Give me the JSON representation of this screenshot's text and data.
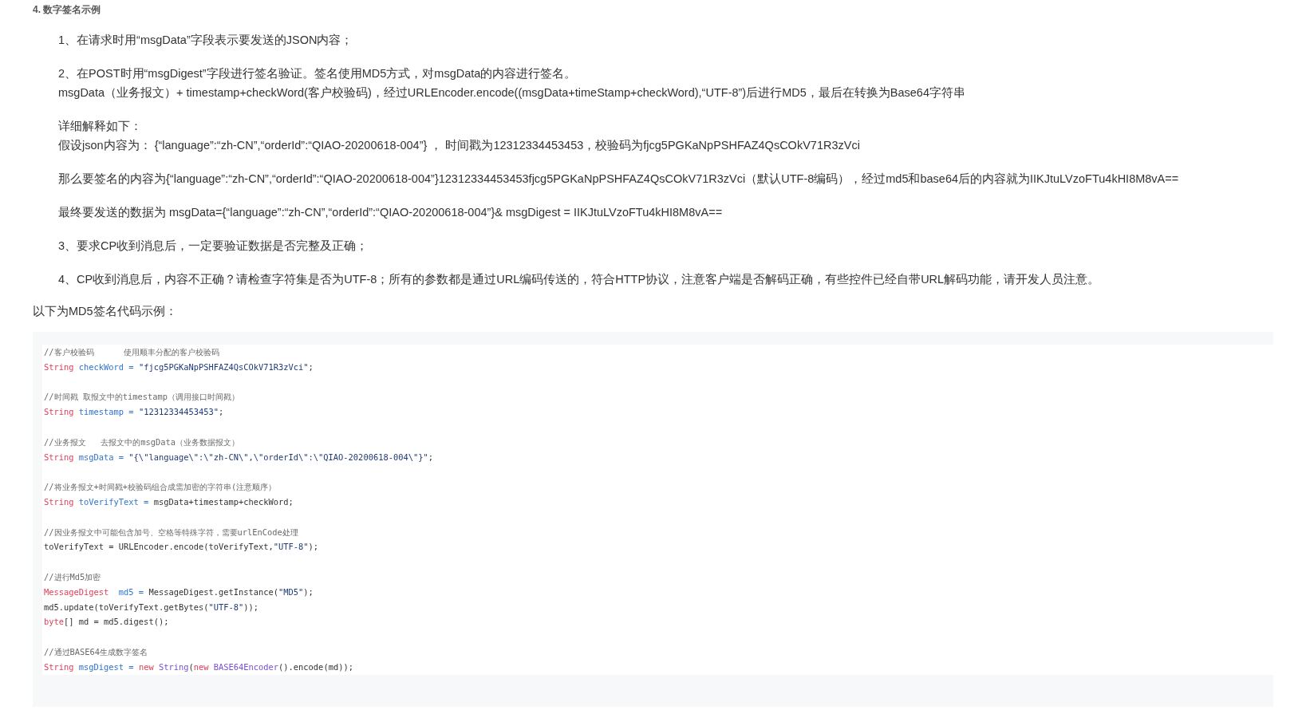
{
  "heading": "4. 数字签名示例",
  "paragraphs": [
    [
      "1、在请求时用“msgData”字段表示要发送的JSON内容；"
    ],
    [
      "2、在POST时用“msgDigest”字段进行签名验证。签名使用MD5方式，对msgData的内容进行签名。",
      "msgData（业务报文）+ timestamp+checkWord(客户校验码)，经过URLEncoder.encode((msgData+timeStamp+checkWord),“UTF-8”)后进行MD5，最后在转换为Base64字符串"
    ],
    [
      "详细解释如下：",
      "假设json内容为： {“language”:“zh-CN”,“orderId”:“QIAO-20200618-004”} ， 时间戳为12312334453453，校验码为fjcg5PGKaNpPSHFAZ4QsCOkV71R3zVci"
    ],
    [
      "那么要签名的内容为{“language”:“zh-CN”,“orderId”:“QIAO-20200618-004”}12312334453453fjcg5PGKaNpPSHFAZ4QsCOkV71R3zVci（默认UTF-8编码），经过md5和base64后的内容就为IIKJtuLVzoFTu4kHI8M8vA=="
    ],
    [
      "最终要发送的数据为 msgData={“language”:“zh-CN”,“orderId”:“QIAO-20200618-004”}& msgDigest = IIKJtuLVzoFTu4kHI8M8vA=="
    ],
    [
      "3、要求CP收到消息后，一定要验证数据是否完整及正确；"
    ],
    [
      "4、CP收到消息后，内容不正确？请检查字符集是否为UTF-8；所有的参数都是通过URL编码传送的，符合HTTP协议，注意客户端是否解码正确，有些控件已经自带URL解码功能，请开发人员注意。"
    ]
  ],
  "intro": "以下为MD5签名代码示例：",
  "code_blocks": [
    [
      [
        {
          "kind": "comment",
          "text": "//客户校验码      使用顺丰分配的客户校验码"
        }
      ],
      [
        {
          "kind": "type",
          "text": "String "
        },
        {
          "kind": "var",
          "text": "checkWord = "
        },
        {
          "kind": "string",
          "text": "\"fjcg5PGKaNpPSHFAZ4QsCOkV71R3zVci\""
        },
        {
          "kind": "plain",
          "text": ";"
        }
      ]
    ],
    [
      [
        {
          "kind": "comment",
          "text": "//时间戳 取报文中的timestamp（调用接口时间戳）"
        }
      ],
      [
        {
          "kind": "type",
          "text": "String "
        },
        {
          "kind": "var",
          "text": "timestamp = "
        },
        {
          "kind": "string",
          "text": "\"12312334453453\""
        },
        {
          "kind": "plain",
          "text": ";"
        }
      ]
    ],
    [
      [
        {
          "kind": "comment",
          "text": "//业务报文   去报文中的msgData（业务数据报文）"
        }
      ],
      [
        {
          "kind": "type",
          "text": "String "
        },
        {
          "kind": "var",
          "text": "msgData = "
        },
        {
          "kind": "string",
          "text": "\"{\\\"language\\\":\\\"zh-CN\\\",\\\"orderId\\\":\\\"QIAO-20200618-004\\\"}\""
        },
        {
          "kind": "plain",
          "text": ";"
        }
      ]
    ],
    [
      [
        {
          "kind": "comment",
          "text": "//将业务报文+时间戳+校验码组合成需加密的字符串(注意顺序）"
        }
      ],
      [
        {
          "kind": "type",
          "text": "String "
        },
        {
          "kind": "var",
          "text": "toVerifyText = "
        },
        {
          "kind": "plain",
          "text": "msgData+timestamp+checkWord;"
        }
      ]
    ],
    [
      [
        {
          "kind": "comment",
          "text": "//因业务报文中可能包含加号、空格等特殊字符，需要urlEnCode处理"
        }
      ],
      [
        {
          "kind": "plain",
          "text": "toVerifyText = URLEncoder.encode(toVerifyText,"
        },
        {
          "kind": "string",
          "text": "\"UTF-8\""
        },
        {
          "kind": "plain",
          "text": ");"
        }
      ]
    ],
    [
      [
        {
          "kind": "comment",
          "text": "//进行Md5加密"
        }
      ],
      [
        {
          "kind": "type",
          "text": "MessageDigest  "
        },
        {
          "kind": "var",
          "text": "md5 = "
        },
        {
          "kind": "plain",
          "text": "MessageDigest.getInstance("
        },
        {
          "kind": "string",
          "text": "\"MD5\""
        },
        {
          "kind": "plain",
          "text": ");"
        }
      ],
      [
        {
          "kind": "plain",
          "text": "md5.update(toVerifyText.getBytes("
        },
        {
          "kind": "string",
          "text": "\"UTF-8\""
        },
        {
          "kind": "plain",
          "text": "));"
        }
      ],
      [
        {
          "kind": "type",
          "text": "byte"
        },
        {
          "kind": "plain",
          "text": "[] md = md5.digest();"
        }
      ]
    ],
    [
      [
        {
          "kind": "comment",
          "text": "//通过BASE64生成数字签名"
        }
      ],
      [
        {
          "kind": "type",
          "text": "String "
        },
        {
          "kind": "var",
          "text": "msgDigest = "
        },
        {
          "kind": "type",
          "text": "new "
        },
        {
          "kind": "class",
          "text": "String"
        },
        {
          "kind": "plain",
          "text": "("
        },
        {
          "kind": "type",
          "text": "new "
        },
        {
          "kind": "class",
          "text": "BASE64Encoder"
        },
        {
          "kind": "plain",
          "text": "().encode(md));"
        }
      ]
    ]
  ]
}
